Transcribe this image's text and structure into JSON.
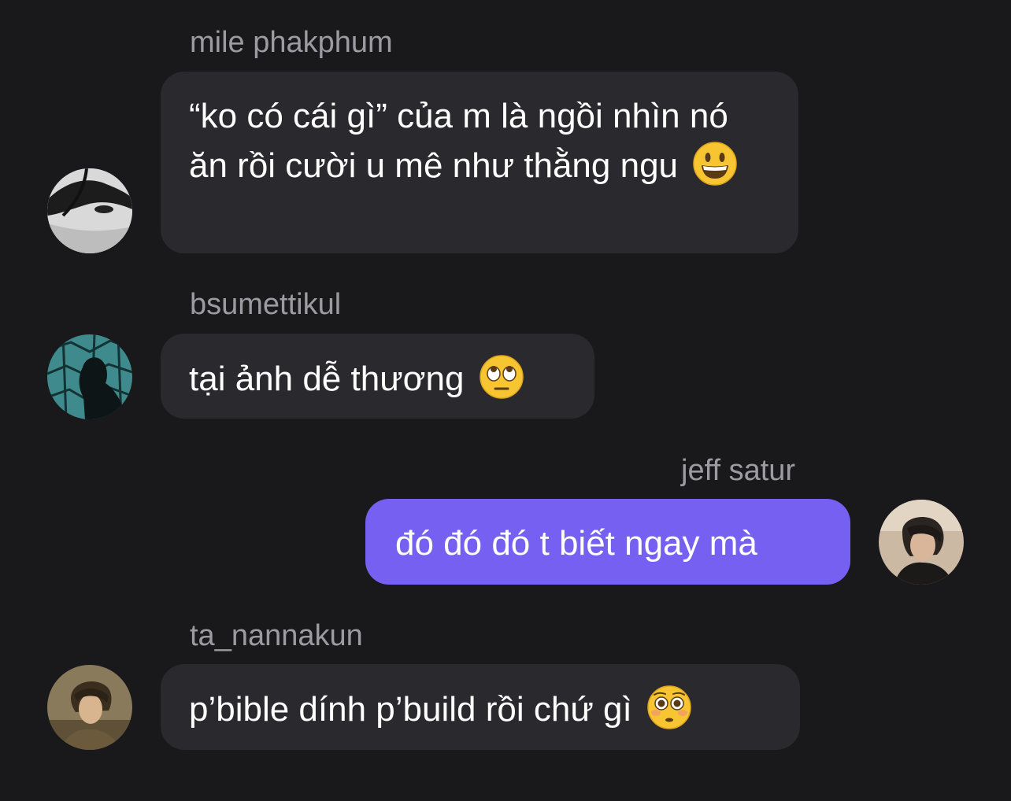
{
  "messages": [
    {
      "sender": "mile phakphum",
      "text": "“ko có cái gì” của m là ngồi nhìn nó ăn rồi cười u mê như thằng ngu",
      "emoji": "grinning-face-icon",
      "avatar": "avatar-mile-phakphum",
      "outgoing": false
    },
    {
      "sender": "bsumettikul",
      "text": "tại ảnh dễ thương",
      "emoji": "rolling-eyes-face-icon",
      "avatar": "avatar-bsumettikul",
      "outgoing": false
    },
    {
      "sender": "jeff satur",
      "text": "đó đó đó t biết ngay mà",
      "emoji": "",
      "avatar": "avatar-jeff-satur",
      "outgoing": true
    },
    {
      "sender": "ta_nannakun",
      "text": "p’bible dính p’build rồi chứ gì",
      "emoji": "flushed-face-icon",
      "avatar": "avatar-ta-nannakun",
      "outgoing": false
    }
  ],
  "colors": {
    "background": "#19181b",
    "incoming_bubble": "#2a292d",
    "outgoing_bubble": "#7660f2",
    "sender_name": "#9c9ba1",
    "message_text": "#ffffff"
  }
}
